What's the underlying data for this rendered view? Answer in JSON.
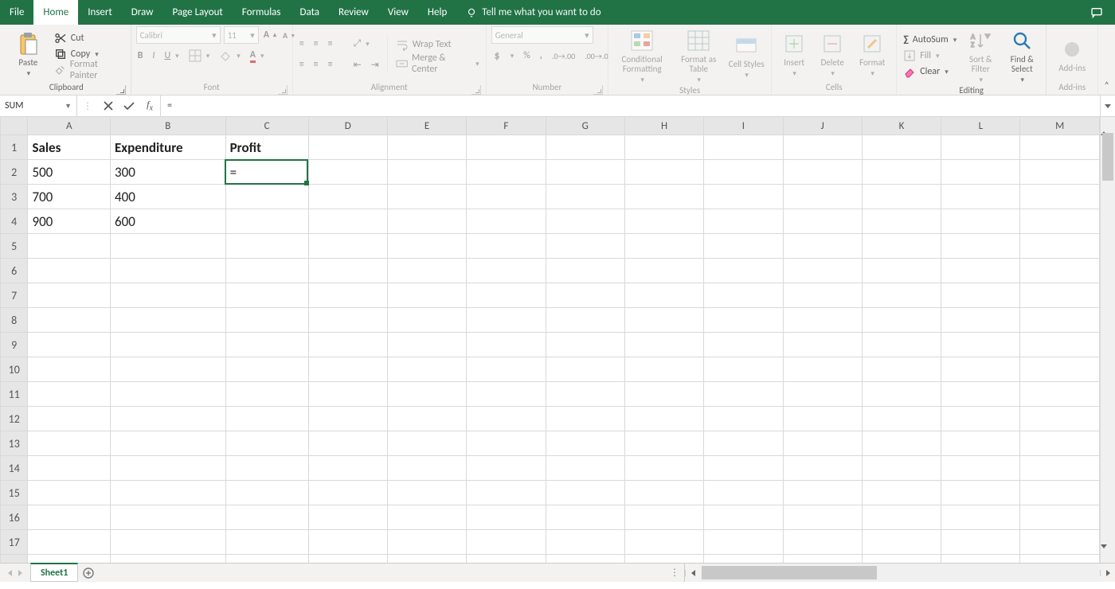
{
  "tabs": {
    "file": "File",
    "home": "Home",
    "insert": "Insert",
    "draw": "Draw",
    "page_layout": "Page Layout",
    "formulas": "Formulas",
    "data": "Data",
    "review": "Review",
    "view": "View",
    "help": "Help",
    "tell_me": "Tell me what you want to do"
  },
  "ribbon": {
    "clipboard": {
      "paste": "Paste",
      "cut": "Cut",
      "copy": "Copy",
      "format_painter": "Format Painter",
      "label": "Clipboard"
    },
    "font": {
      "name": "Calibri",
      "size": "11",
      "label": "Font"
    },
    "alignment": {
      "wrap": "Wrap Text",
      "merge": "Merge & Center",
      "label": "Alignment"
    },
    "number": {
      "format": "General",
      "label": "Number"
    },
    "styles": {
      "cond": "Conditional Formatting",
      "table": "Format as Table",
      "cell": "Cell Styles",
      "label": "Styles"
    },
    "cells": {
      "insert": "Insert",
      "delete": "Delete",
      "format": "Format",
      "label": "Cells"
    },
    "editing": {
      "autosum": "AutoSum",
      "fill": "Fill",
      "clear": "Clear",
      "sort": "Sort & Filter",
      "find": "Find & Select",
      "label": "Editing"
    },
    "addins": {
      "btn": "Add-ins",
      "label": "Add-ins"
    }
  },
  "formula_bar": {
    "name_box": "SUM",
    "formula": "="
  },
  "grid": {
    "columns": [
      "A",
      "B",
      "C",
      "D",
      "E",
      "F",
      "G",
      "H",
      "I",
      "J",
      "K",
      "L",
      "M"
    ],
    "row_count": 18,
    "headers": {
      "A1": "Sales",
      "B1": "Expenditure",
      "C1": "Profit"
    },
    "data": {
      "A2": "500",
      "B2": "300",
      "C2": "=",
      "A3": "700",
      "B3": "400",
      "A4": "900",
      "B4": "600"
    },
    "active_cell": "C2"
  },
  "sheet_tabs": {
    "active": "Sheet1"
  }
}
